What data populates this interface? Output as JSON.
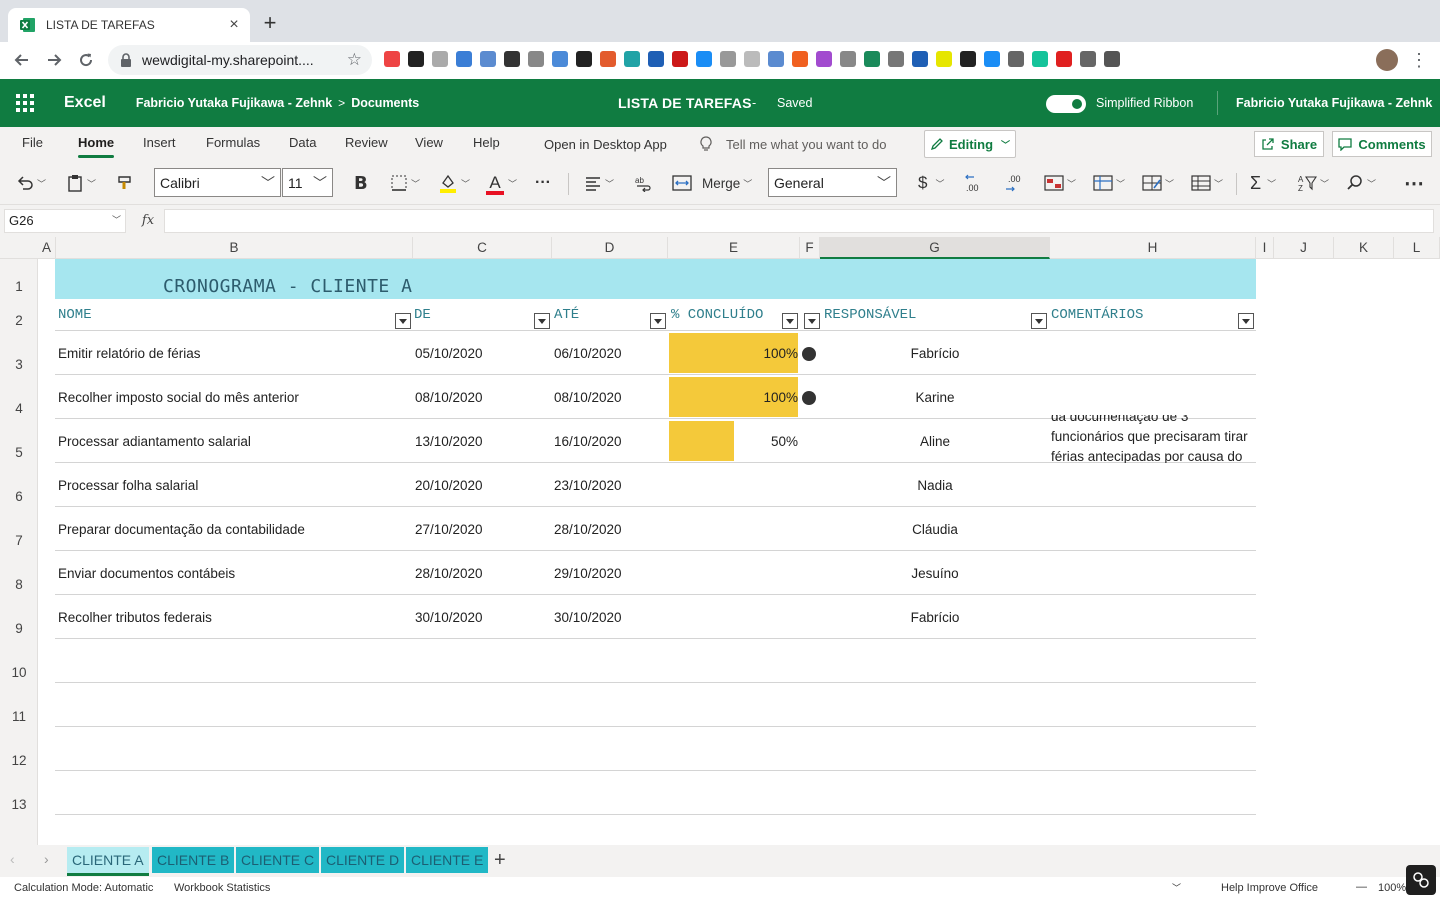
{
  "browser": {
    "tab_title": "LISTA DE TAREFAS",
    "tab_close": "×",
    "new_tab": "+",
    "url": "wewdigital-my.sharepoint....",
    "extension_colors": [
      "#e44",
      "#222",
      "#aaa",
      "#3b7ed6",
      "#5b8bd0",
      "#333",
      "#888",
      "#4b8ad8",
      "#222",
      "#e35b2d",
      "#21a3a6",
      "#1f5fb5",
      "#cc1818",
      "#1a8df5",
      "#999",
      "#bbb",
      "#5b8bd0",
      "#f06020",
      "#a24bcf",
      "#888",
      "#1a8a5a",
      "#777",
      "#1f5fb5",
      "#e6e600",
      "#222",
      "#1a8df5",
      "#666",
      "#15c39a",
      "#e02020",
      "#666",
      "#555"
    ]
  },
  "excel_header": {
    "app": "Excel",
    "breadcrumb_owner": "Fabricio Yutaka Fujikawa - Zehnk",
    "breadcrumb_sep": ">",
    "breadcrumb_folder": "Documents",
    "doc_title": "LISTA DE TAREFAS",
    "doc_sep": "-",
    "save_status": "Saved",
    "simplified_ribbon": "Simplified Ribbon",
    "user": "Fabricio Yutaka Fujikawa - Zehnk"
  },
  "menu": {
    "file": "File",
    "home": "Home",
    "insert": "Insert",
    "formulas": "Formulas",
    "data": "Data",
    "review": "Review",
    "view": "View",
    "help": "Help",
    "open_desktop": "Open in Desktop App",
    "tell_me": "Tell me what you want to do",
    "editing": "Editing",
    "share": "Share",
    "comments": "Comments"
  },
  "ribbon": {
    "font_name": "Calibri",
    "font_size": "11",
    "bold": "B",
    "font_color_letter": "A",
    "more": "···",
    "merge": "Merge",
    "number_format": "General",
    "currency": "$",
    "overflow": "⋯"
  },
  "formula_bar": {
    "name_box": "G26",
    "fx": "fx",
    "formula": ""
  },
  "columns": [
    "A",
    "B",
    "C",
    "D",
    "E",
    "F",
    "G",
    "H",
    "I",
    "J",
    "K",
    "L"
  ],
  "rows": [
    "1",
    "2",
    "3",
    "4",
    "5",
    "6",
    "7",
    "8",
    "9",
    "10",
    "11",
    "12",
    "13"
  ],
  "sheet": {
    "banner": "CRONOGRAMA - CLIENTE A",
    "headers": {
      "nome": "NOME",
      "de": "DE",
      "ate": "ATÉ",
      "concluido": "% CONCLUÍDO",
      "responsavel": "RESPONSÁVEL",
      "comentarios": "COMENTÁRIOS"
    },
    "tasks": [
      {
        "nome": "Emitir relatório de férias",
        "de": "05/10/2020",
        "ate": "06/10/2020",
        "pct": "100%",
        "pct_value": 1.0,
        "responsavel": "Fabrício"
      },
      {
        "nome": "Recolher imposto social do mês anterior",
        "de": "08/10/2020",
        "ate": "08/10/2020",
        "pct": "100%",
        "pct_value": 1.0,
        "responsavel": "Karine"
      },
      {
        "nome": "Processar adiantamento salarial",
        "de": "13/10/2020",
        "ate": "16/10/2020",
        "pct": "50%",
        "pct_value": 0.5,
        "responsavel": "Aline"
      },
      {
        "nome": "Processar folha salarial",
        "de": "20/10/2020",
        "ate": "23/10/2020",
        "pct": "",
        "pct_value": 0,
        "responsavel": "Nadia"
      },
      {
        "nome": "Preparar documentação da contabilidade",
        "de": "27/10/2020",
        "ate": "28/10/2020",
        "pct": "",
        "pct_value": 0,
        "responsavel": "Cláudia"
      },
      {
        "nome": "Enviar documentos contábeis",
        "de": "28/10/2020",
        "ate": "29/10/2020",
        "pct": "",
        "pct_value": 0,
        "responsavel": "Jesuíno"
      },
      {
        "nome": "Recolher tributos federais",
        "de": "30/10/2020",
        "ate": "30/10/2020",
        "pct": "",
        "pct_value": 0,
        "responsavel": "Fabrício"
      }
    ],
    "comment_row5_line1": "da documentação de 3",
    "comment_row5_line2": "funcionários que precisaram tirar",
    "comment_row5_line3": "férias antecipadas por causa do"
  },
  "sheet_tabs": [
    "CLIENTE A",
    "CLIENTE B",
    "CLIENTE C",
    "CLIENTE D",
    "CLIENTE E"
  ],
  "add_sheet": "+",
  "status_bar": {
    "calc_mode": "Calculation Mode: Automatic",
    "workbook_stats": "Workbook Statistics",
    "help_improve": "Help Improve Office",
    "zoom_minus": "—",
    "zoom": "100%"
  },
  "colors": {
    "excel_green": "#107c41",
    "banner": "#a6e6ef",
    "progress": "#f4c93a",
    "header_text": "#2f7f8c",
    "sheet_tab": "#21b8c6"
  }
}
